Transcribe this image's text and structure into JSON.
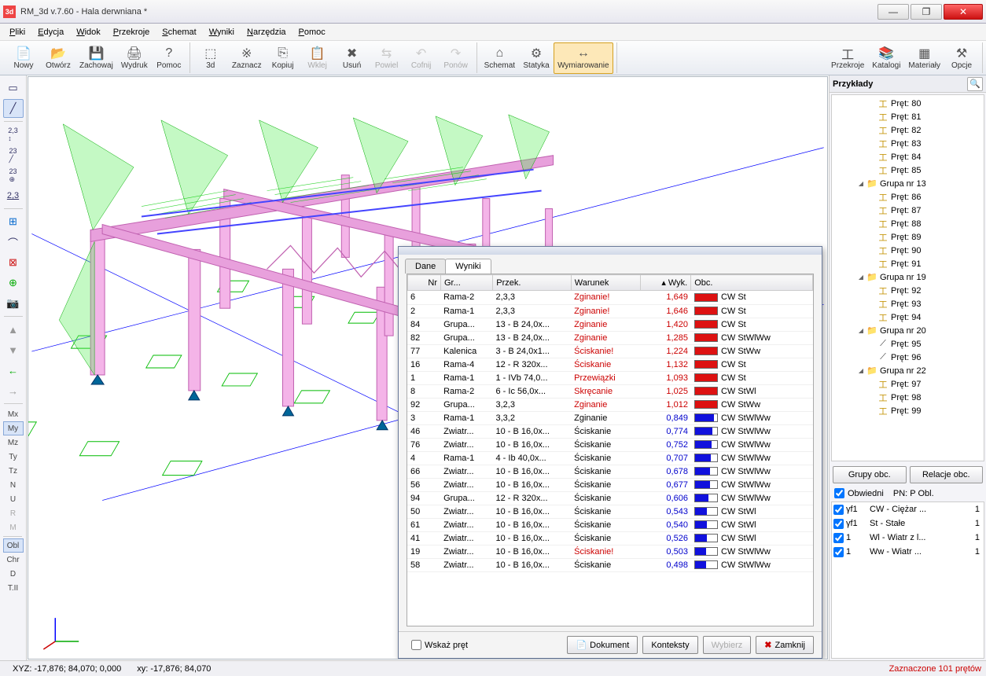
{
  "window": {
    "title": "RM_3d v.7.60 - Hala derwniana *"
  },
  "menu": {
    "items": [
      "Pliki",
      "Edycja",
      "Widok",
      "Przekroje",
      "Schemat",
      "Wyniki",
      "Narzędzia",
      "Pomoc"
    ]
  },
  "toolbar": {
    "g1": [
      {
        "id": "nowy",
        "label": "Nowy",
        "ico": "📄"
      },
      {
        "id": "otworz",
        "label": "Otwórz",
        "ico": "📂"
      },
      {
        "id": "zachowaj",
        "label": "Zachowaj",
        "ico": "💾"
      },
      {
        "id": "wydruk",
        "label": "Wydruk",
        "ico": "🖨"
      },
      {
        "id": "pomoc",
        "label": "Pomoc",
        "ico": "?"
      }
    ],
    "g2": [
      {
        "id": "3d",
        "label": "3d",
        "ico": "⬚"
      },
      {
        "id": "zaznacz",
        "label": "Zaznacz",
        "ico": "※"
      },
      {
        "id": "kopiuj",
        "label": "Kopiuj",
        "ico": "⎘"
      },
      {
        "id": "wklej",
        "label": "Wklej",
        "ico": "📋",
        "disabled": true
      },
      {
        "id": "usun",
        "label": "Usuń",
        "ico": "✖"
      },
      {
        "id": "powiel",
        "label": "Powiel",
        "ico": "⇆",
        "disabled": true
      },
      {
        "id": "cofnij",
        "label": "Cofnij",
        "ico": "↶",
        "disabled": true
      },
      {
        "id": "ponow",
        "label": "Ponów",
        "ico": "↷",
        "disabled": true
      }
    ],
    "g3": [
      {
        "id": "schemat",
        "label": "Schemat",
        "ico": "⌂"
      },
      {
        "id": "statyka",
        "label": "Statyka",
        "ico": "⚙"
      },
      {
        "id": "wymiarowanie",
        "label": "Wymiarowanie",
        "ico": "↔",
        "active": true
      }
    ],
    "g4": [
      {
        "id": "przekroje",
        "label": "Przekroje",
        "ico": "工"
      },
      {
        "id": "katalogi",
        "label": "Katalogi",
        "ico": "📚"
      },
      {
        "id": "materialy",
        "label": "Materiały",
        "ico": "▦"
      },
      {
        "id": "opcje",
        "label": "Opcje",
        "ico": "⚒"
      }
    ]
  },
  "left_labels": [
    "Mx",
    "My",
    "Mz",
    "Ty",
    "Tz",
    "N",
    "U",
    "R",
    "M",
    "Obl",
    "Chr",
    "D",
    "T.II"
  ],
  "right": {
    "header": "Przykłady",
    "tree_pret_start": [
      "Pręt: 80",
      "Pręt: 81",
      "Pręt: 82",
      "Pręt: 83",
      "Pręt: 84",
      "Pręt: 85"
    ],
    "groups": [
      {
        "name": "Grupa nr 13",
        "items": [
          "Pręt: 86",
          "Pręt: 87",
          "Pręt: 88",
          "Pręt: 89",
          "Pręt: 90",
          "Pręt: 91"
        ]
      },
      {
        "name": "Grupa nr 19",
        "items": [
          "Pręt: 92",
          "Pręt: 93",
          "Pręt: 94"
        ]
      },
      {
        "name": "Grupa nr 20",
        "items": [
          "Pręt: 95",
          "Pręt: 96"
        ],
        "lineIcon": true
      },
      {
        "name": "Grupa nr 22",
        "items": [
          "Pręt: 97",
          "Pręt: 98",
          "Pręt: 99"
        ]
      }
    ],
    "btn_grupy": "Grupy obc.",
    "btn_relacje": "Relacje obc.",
    "chk_obwiedni": "Obwiedni",
    "pn_label": "PN:  P Obl.",
    "loads": [
      {
        "c": true,
        "a": "γf1",
        "b": "CW - Ciężar ...",
        "v": "1"
      },
      {
        "c": true,
        "a": "γf1",
        "b": "St - Stałe",
        "v": "1"
      },
      {
        "c": true,
        "a": "1",
        "b": "Wl - Wiatr z l...",
        "v": "1"
      },
      {
        "c": true,
        "a": "1",
        "b": "Ww - Wiatr ...",
        "v": "1"
      }
    ]
  },
  "dialog": {
    "tabs": [
      "Dane",
      "Wyniki"
    ],
    "active_tab": 1,
    "columns": [
      "Nr",
      "Gr...",
      "Przek.",
      "Warunek",
      "Wyk.",
      "Obc."
    ],
    "sort_col": "Wyk.",
    "rows": [
      {
        "nr": "6",
        "gr": "Rama-2",
        "prz": "2,3,3",
        "war": "Zginanie!",
        "wyk": "1,649",
        "red": true,
        "obc": "CW St",
        "fill": 100
      },
      {
        "nr": "2",
        "gr": "Rama-1",
        "prz": "2,3,3",
        "war": "Zginanie!",
        "wyk": "1,646",
        "red": true,
        "obc": "CW St",
        "fill": 100
      },
      {
        "nr": "84",
        "gr": "Grupa...",
        "prz": "13 - B 24,0x...",
        "war": "Zginanie",
        "wyk": "1,420",
        "red": true,
        "obc": "CW St",
        "fill": 100
      },
      {
        "nr": "82",
        "gr": "Grupa...",
        "prz": "13 - B 24,0x...",
        "war": "Zginanie",
        "wyk": "1,285",
        "red": true,
        "obc": "CW StWlWw",
        "fill": 100
      },
      {
        "nr": "77",
        "gr": "Kalenica",
        "prz": "3 - B 24,0x1...",
        "war": "Ściskanie!",
        "wyk": "1,224",
        "red": true,
        "obc": "CW StWw",
        "fill": 100
      },
      {
        "nr": "16",
        "gr": "Rama-4",
        "prz": "12 - R 320x...",
        "war": "Ściskanie",
        "wyk": "1,132",
        "red": true,
        "obc": "CW St",
        "fill": 100
      },
      {
        "nr": "1",
        "gr": "Rama-1",
        "prz": "1 - IVb 74,0...",
        "war": "Przewiązki",
        "wyk": "1,093",
        "red": true,
        "obc": "CW St",
        "fill": 100
      },
      {
        "nr": "8",
        "gr": "Rama-2",
        "prz": "6 - Ic 56,0x...",
        "war": "Skręcanie",
        "wyk": "1,025",
        "red": true,
        "obc": "CW StWl",
        "fill": 100
      },
      {
        "nr": "92",
        "gr": "Grupa...",
        "prz": "3,2,3",
        "war": "Zginanie",
        "wyk": "1,012",
        "red": true,
        "obc": "CW StWw",
        "fill": 100
      },
      {
        "nr": "3",
        "gr": "Rama-1",
        "prz": "3,3,2",
        "war": "Zginanie",
        "wyk": "0,849",
        "red": false,
        "obc": "CW StWlWw",
        "fill": 85
      },
      {
        "nr": "46",
        "gr": "Zwiatr...",
        "prz": "10 - B 16,0x...",
        "war": "Ściskanie",
        "wyk": "0,774",
        "red": false,
        "obc": "CW StWlWw",
        "fill": 77
      },
      {
        "nr": "76",
        "gr": "Zwiatr...",
        "prz": "10 - B 16,0x...",
        "war": "Ściskanie",
        "wyk": "0,752",
        "red": false,
        "obc": "CW StWlWw",
        "fill": 75
      },
      {
        "nr": "4",
        "gr": "Rama-1",
        "prz": "4 - Ib 40,0x...",
        "war": "Ściskanie",
        "wyk": "0,707",
        "red": false,
        "obc": "CW StWlWw",
        "fill": 71
      },
      {
        "nr": "66",
        "gr": "Zwiatr...",
        "prz": "10 - B 16,0x...",
        "war": "Ściskanie",
        "wyk": "0,678",
        "red": false,
        "obc": "CW StWlWw",
        "fill": 68
      },
      {
        "nr": "56",
        "gr": "Zwiatr...",
        "prz": "10 - B 16,0x...",
        "war": "Ściskanie",
        "wyk": "0,677",
        "red": false,
        "obc": "CW StWlWw",
        "fill": 68
      },
      {
        "nr": "94",
        "gr": "Grupa...",
        "prz": "12 - R 320x...",
        "war": "Ściskanie",
        "wyk": "0,606",
        "red": false,
        "obc": "CW StWlWw",
        "fill": 61
      },
      {
        "nr": "50",
        "gr": "Zwiatr...",
        "prz": "10 - B 16,0x...",
        "war": "Ściskanie",
        "wyk": "0,543",
        "red": false,
        "obc": "CW StWl",
        "fill": 54
      },
      {
        "nr": "61",
        "gr": "Zwiatr...",
        "prz": "10 - B 16,0x...",
        "war": "Ściskanie",
        "wyk": "0,540",
        "red": false,
        "obc": "CW StWl",
        "fill": 54
      },
      {
        "nr": "41",
        "gr": "Zwiatr...",
        "prz": "10 - B 16,0x...",
        "war": "Ściskanie",
        "wyk": "0,526",
        "red": false,
        "obc": "CW StWl",
        "fill": 53
      },
      {
        "nr": "19",
        "gr": "Zwiatr...",
        "prz": "10 - B 16,0x...",
        "war": "Ściskanie!",
        "wyk": "0,503",
        "red": false,
        "warRed": true,
        "obc": "CW StWlWw",
        "fill": 50
      },
      {
        "nr": "58",
        "gr": "Zwiatr...",
        "prz": "10 - B 16,0x...",
        "war": "Ściskanie",
        "wyk": "0,498",
        "red": false,
        "obc": "CW StWlWw",
        "fill": 50
      }
    ],
    "chk_wskaz": "Wskaż pręt",
    "btn_dokument": "Dokument",
    "btn_konteksty": "Konteksty",
    "btn_wybierz": "Wybierz",
    "btn_zamknij": "Zamknij"
  },
  "status": {
    "xyz_l": "XYZ:",
    "xyz_v": "-17,876; 84,070; 0,000",
    "xy_l": "xy:",
    "xy_v": "-17,876; 84,070",
    "right": "Zaznaczone 101 prętów"
  }
}
